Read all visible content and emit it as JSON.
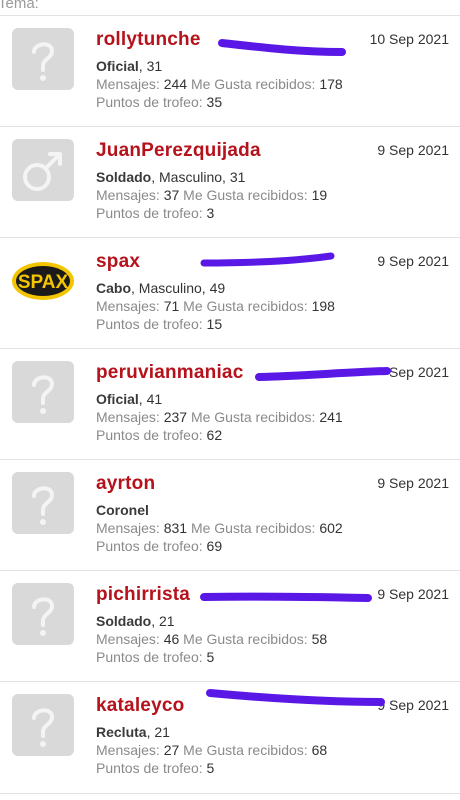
{
  "header": {
    "label": "Tema:"
  },
  "labels": {
    "mensajes": "Mensajes:",
    "me_gusta": "Me Gusta recibidos:",
    "puntos": "Puntos de trofeo:"
  },
  "colors": {
    "username": "#b5121b",
    "redaction": "#5a18e6",
    "divider": "#e2e2e2"
  },
  "users": [
    {
      "name": "rollytunche",
      "rank": "Oficial",
      "details": ", 31",
      "date": "10 Sep 2021",
      "mensajes": "244",
      "me_gusta": "178",
      "puntos": "35",
      "avatar": "question-mark-icon"
    },
    {
      "name": "JuanPerezquijada",
      "rank": "Soldado",
      "details": ", Masculino, 31",
      "date": "9 Sep 2021",
      "mensajes": "37",
      "me_gusta": "19",
      "puntos": "3",
      "avatar": "male-symbol-icon"
    },
    {
      "name": "spax",
      "rank": "Cabo",
      "details": ", Masculino, 49",
      "date": "9 Sep 2021",
      "mensajes": "71",
      "me_gusta": "198",
      "puntos": "15",
      "avatar": "spax-logo"
    },
    {
      "name": "peruvianmaniac",
      "rank": "Oficial",
      "details": ", 41",
      "date": "Sep 2021",
      "mensajes": "237",
      "me_gusta": "241",
      "puntos": "62",
      "avatar": "question-mark-icon"
    },
    {
      "name": "ayrton",
      "rank": "Coronel",
      "details": "",
      "date": "9 Sep 2021",
      "mensajes": "831",
      "me_gusta": "602",
      "puntos": "69",
      "avatar": "question-mark-icon"
    },
    {
      "name": "pichirrista",
      "rank": "Soldado",
      "details": ", 21",
      "date": "9 Sep 2021",
      "mensajes": "46",
      "me_gusta": "58",
      "puntos": "5",
      "avatar": "question-mark-icon"
    },
    {
      "name": "kataleyco",
      "rank": "Recluta",
      "details": ", 21",
      "date": "9 Sep 2021",
      "mensajes": "27",
      "me_gusta": "68",
      "puntos": "5",
      "avatar": "question-mark-icon"
    }
  ]
}
